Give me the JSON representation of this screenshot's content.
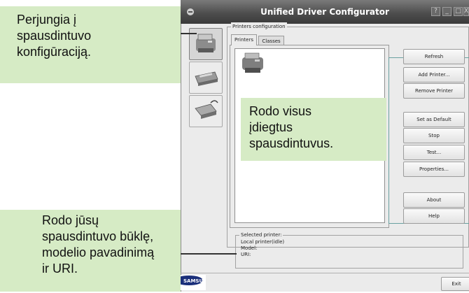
{
  "window": {
    "title": "Unified Driver Configurator",
    "controls": [
      "?",
      "_",
      "□",
      "X"
    ]
  },
  "nav": [
    {
      "name": "printers-config",
      "icon": "printer-icon",
      "selected": true
    },
    {
      "name": "scanners-config",
      "icon": "scanner-icon",
      "selected": false
    },
    {
      "name": "ports-config",
      "icon": "port-icon",
      "selected": false
    }
  ],
  "group": {
    "title": "Printers configuration",
    "tabs": [
      "Printers",
      "Classes"
    ],
    "active_tab": "Printers"
  },
  "buttons": {
    "refresh": "Refresh",
    "add_printer": "Add Printer...",
    "remove_printer": "Remove Printer",
    "set_default": "Set as Default",
    "stop": "Stop",
    "test": "Test...",
    "properties": "Properties...",
    "about": "About",
    "help": "Help"
  },
  "selected_printer": {
    "title": "Selected printer:",
    "lines": [
      "Local printer(idle)",
      "Model:",
      "URI:"
    ]
  },
  "exit_label": "Exit",
  "logo_text": "SAMSUNG",
  "callouts": {
    "top_left": [
      "Perjungia į",
      "spausdintuvo",
      "konfigūraciją."
    ],
    "center": [
      "Rodo visus",
      "įdiegtus",
      "spausdintuvus."
    ],
    "bottom_left": [
      "Rodo jūsų",
      "spausdintuvo būklę,",
      "modelio pavadinimą",
      "ir URI."
    ]
  }
}
